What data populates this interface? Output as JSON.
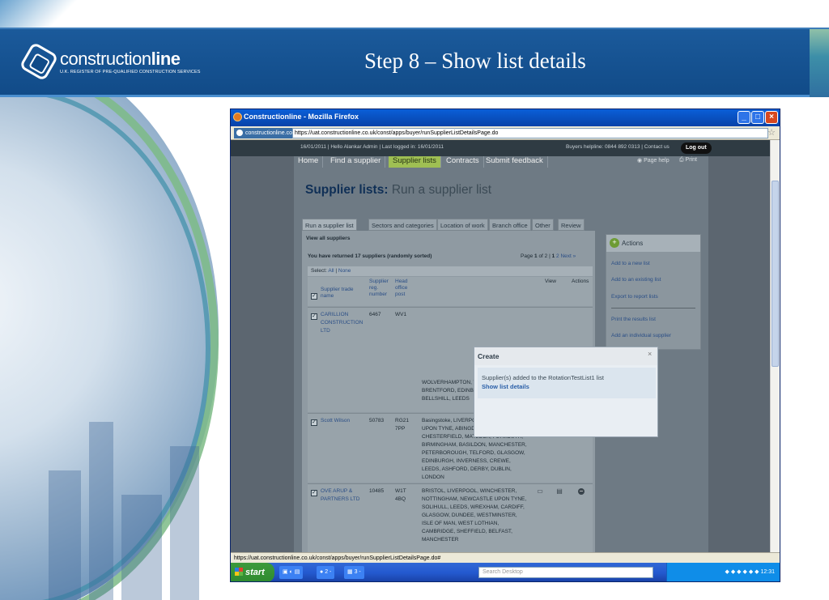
{
  "slide": {
    "title": "Step 8 – Show list details",
    "logo_text_regular": "construction",
    "logo_text_bold": "line",
    "logo_tagline": "U.K. REGISTER OF PRE-QUALIFIED CONSTRUCTION SERVICES"
  },
  "browser": {
    "window_title": "Constructionline - Mozilla Firefox",
    "site_identity": "constructionline.co.uk",
    "url": "https://uat.constructionline.co.uk/const/apps/buyer/runSupplierListDetailsPage.do",
    "status_url": "https://uat.constructionline.co.uk/const/apps/buyer/runSupplierListDetailsPage.do#"
  },
  "site": {
    "info_bar": "16/01/2011  |  Hello Alankar Admin  |  Last logged in: 16/01/2011",
    "helpline": "Buyers helpline: 0844 892 0313  |  Contact us",
    "logout": "Log out",
    "nav": [
      "Home",
      "Find a supplier",
      "Supplier lists",
      "Contracts",
      "Submit feedback"
    ],
    "nav_right": [
      "Page help",
      "Print"
    ],
    "page_heading_bold": "Supplier lists:",
    "page_heading_rest": "Run a supplier list",
    "tabs": [
      "Run a supplier list",
      "Sectors and categories",
      "Location of work",
      "Branch office",
      "Other",
      "Review"
    ],
    "panel_title": "View all suppliers",
    "returned_text": "You have returned 17 suppliers (randomly sorted)",
    "pager": {
      "label": "Page",
      "current": "1",
      "of": "of 2",
      "pages": [
        "1",
        "2"
      ],
      "next": "Next »"
    },
    "select": {
      "label": "Select:",
      "all": "All",
      "none": "None"
    },
    "columns": {
      "name": "Supplier trade name",
      "reg": "Supplier reg. number",
      "head": "Head office post",
      "view": "View",
      "actions": "Actions"
    },
    "rows": [
      {
        "name": "CARILLION CONSTRUCTION LTD",
        "reg": "6467",
        "post": "WV1",
        "locations": "WOLVERHAMPTON, WOLVERHAMPTON, BRENTFORD, EDINBURGH, GLASGOW, BELLSHILL, LEEDS"
      },
      {
        "name": "Scott Wilson",
        "reg": "50783",
        "post": "RG21 7PP",
        "locations": "Basingstoke, LIVERPOOL, NEWCASTLE UPON TYNE, ABINGDON, CHESTERFIELD, MATLOCK, PLYMOUTH, BIRMINGHAM, BASILDON, MANCHESTER, PETERBOROUGH, TELFORD, GLASGOW, EDINBURGH, INVERNESS, CREWE, LEEDS, ASHFORD, DERBY, DUBLIN, LONDON"
      },
      {
        "name": "OVE ARUP & PARTNERS LTD",
        "reg": "10485",
        "post": "W1T 4BQ",
        "locations": "BRISTOL, LIVERPOOL, WINCHESTER, NOTTINGHAM, NEWCASTLE UPON TYNE, SOLIHULL, LEEDS, WREXHAM, CARDIFF, GLASGOW, DUNDEE, WESTMINSTER, ISLE OF MAN, WEST LOTHIAN, CAMBRIDGE, SHEFFIELD, BELFAST, MANCHESTER"
      }
    ],
    "actions": {
      "title": "Actions",
      "links": [
        "Add to a new list",
        "Add to an existing list",
        "Export to report lists",
        "Print the results list",
        "Add an individual supplier"
      ]
    },
    "modal": {
      "title": "Create",
      "close": "×",
      "message": "Supplier(s) added to the RotationTestList1 list",
      "link": "Show list details"
    }
  },
  "taskbar": {
    "start": "start",
    "item1": "2 -",
    "item2": "3 -",
    "search_placeholder": "Search Desktop",
    "clock": "12:31"
  }
}
